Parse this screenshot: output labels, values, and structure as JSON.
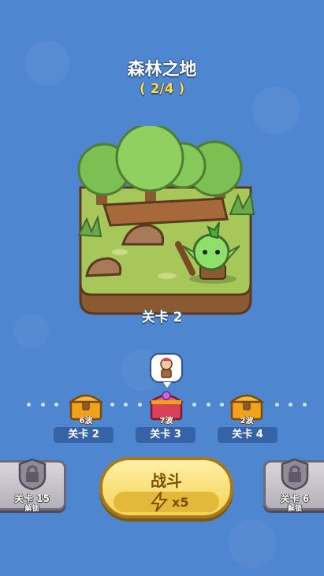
{
  "area": {
    "title": "森林之地",
    "progress": "( 2/4 )"
  },
  "current_level_caption": "关卡 2",
  "nodes": [
    {
      "waves": "6波",
      "label": "关卡 2",
      "state": "opened"
    },
    {
      "waves": "7波",
      "label": "关卡 3",
      "state": "current"
    },
    {
      "waves": "2波",
      "label": "关卡 4",
      "state": "upcoming"
    }
  ],
  "fight_button": {
    "label": "战斗",
    "cost": "x5"
  },
  "left_button": {
    "level": "关卡 15",
    "unlock": "解锁"
  },
  "right_button": {
    "level": "关卡 6",
    "unlock": "解锁"
  },
  "colors": {
    "background": "#4f86d0",
    "button_gold": "#f6d255",
    "chest_gold": "#f0a21c",
    "chest_red": "#d9405a"
  },
  "icons": [
    "chest-icon",
    "lock-icon",
    "lightning-icon",
    "goblin-character",
    "hero-avatar-icon"
  ]
}
